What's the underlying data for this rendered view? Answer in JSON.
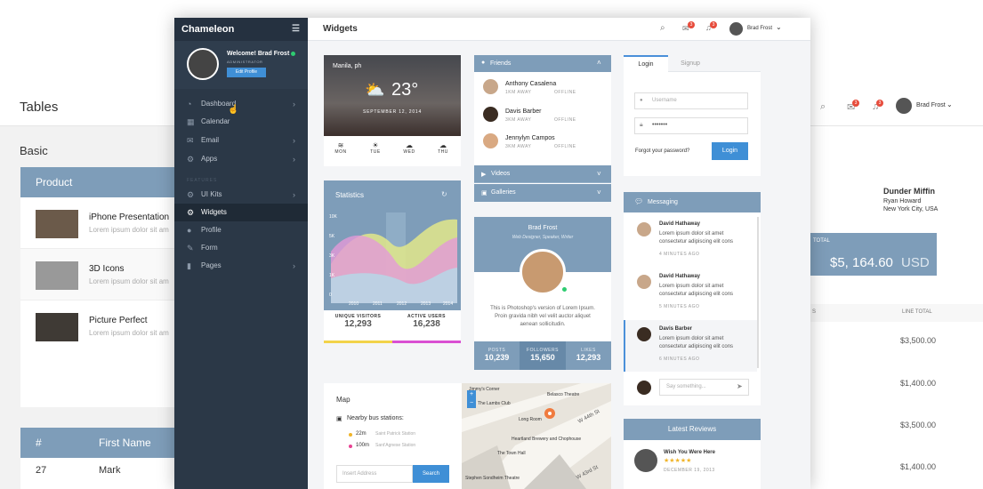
{
  "background_page": {
    "title": "Tables",
    "section": "Basic",
    "table_header": "Product",
    "products": [
      {
        "name": "iPhone Presentation",
        "desc": "Lorem ipsum dolor sit am"
      },
      {
        "name": "3D Icons",
        "desc": "Lorem ipsum dolor sit am"
      },
      {
        "name": "Picture Perfect",
        "desc": "Lorem ipsum dolor sit am"
      }
    ],
    "table2_headers": [
      "#",
      "First Name"
    ],
    "table2_row": [
      "27",
      "Mark"
    ],
    "user_name": "Brad Frost",
    "badge1": "3",
    "badge2": "3",
    "company": "Dunder Miffin",
    "contact": "Ryan Howard",
    "city": "New York City, USA",
    "total_label": "TOTAL",
    "total_value": "$5, 164.60",
    "total_currency": "USD",
    "col_label_left": "S",
    "col_label": "LINE TOTAL",
    "line_totals": [
      "$3,500.00",
      "$1,400.00",
      "$3,500.00",
      "$1,400.00"
    ]
  },
  "sidebar": {
    "brand": "Chameleon",
    "greeting": "Welcome! Brad Frost",
    "role": "ADMINISTRATOR",
    "edit_profile": "Edit Profile",
    "section_label": "FEATURES",
    "items": [
      {
        "label": "Dashboard",
        "icon": "dashboard-icon",
        "chevron": true
      },
      {
        "label": "Calendar",
        "icon": "calendar-icon",
        "chevron": false
      },
      {
        "label": "Email",
        "icon": "email-icon",
        "chevron": true
      },
      {
        "label": "Apps",
        "icon": "apps-icon",
        "chevron": true
      },
      {
        "label": "UI Kits",
        "icon": "ui-kits-icon",
        "chevron": true
      },
      {
        "label": "Widgets",
        "icon": "widgets-icon",
        "chevron": false
      },
      {
        "label": "Profile",
        "icon": "profile-icon",
        "chevron": false
      },
      {
        "label": "Form",
        "icon": "form-icon",
        "chevron": false
      },
      {
        "label": "Pages",
        "icon": "pages-icon",
        "chevron": true
      }
    ]
  },
  "header": {
    "title": "Widgets",
    "mail_badge": "3",
    "bell_badge": "3",
    "user": "Brad Frost"
  },
  "weather": {
    "location": "Manila, ph",
    "temp": "23°",
    "date": "SEPTEMBER 12, 2014",
    "days": [
      {
        "label": "MON",
        "icon": "≋"
      },
      {
        "label": "TUE",
        "icon": "☀"
      },
      {
        "label": "WED",
        "icon": "☁"
      },
      {
        "label": "THU",
        "icon": "☁"
      }
    ]
  },
  "statistics": {
    "title": "Statistics",
    "ylabels": [
      "10K",
      "5K",
      "3K",
      "1K",
      "0"
    ],
    "xlabels": [
      "2010",
      "2011",
      "2012",
      "2013",
      "2014"
    ],
    "stat1_label": "UNIQUE VISITORS",
    "stat1_value": "12,293",
    "stat2_label": "ACTIVE USERS",
    "stat2_value": "16,238"
  },
  "friends": {
    "title": "Friends",
    "people": [
      {
        "name": "Anthony Casalena",
        "distance": "1KM AWAY",
        "status": "OFFLINE"
      },
      {
        "name": "Davis Barber",
        "distance": "3KM AWAY",
        "status": "OFFLINE"
      },
      {
        "name": "Jennylyn Campos",
        "distance": "3KM AWAY",
        "status": "OFFLINE"
      }
    ],
    "videos": "Videos",
    "galleries": "Galleries"
  },
  "profile": {
    "name": "Brad Frost",
    "subtitle": "Web Designer, Speaker, Writer",
    "bio": "This is Photoshop's version  of Lorem Ipsum. Proin gravida nibh vel velit auctor aliquet aenean sollicitudin.",
    "stats": [
      {
        "label": "POSTS",
        "value": "10,239"
      },
      {
        "label": "FOLLOWERS",
        "value": "15,650"
      },
      {
        "label": "LIKES",
        "value": "12,293"
      }
    ]
  },
  "login": {
    "tab_login": "Login",
    "tab_signup": "Signup",
    "username_placeholder": "Username",
    "password_value": "•••••••",
    "forgot": "Forgot your password?",
    "button": "Login"
  },
  "messaging": {
    "title": "Messaging",
    "messages": [
      {
        "name": "David Hathaway",
        "text": "Lorem ipsum dolor sit amet consectetur adipiscing elit cons",
        "time": "4 MINUTES AGO"
      },
      {
        "name": "David Hathaway",
        "text": "Lorem ipsum dolor sit amet consectetur adipiscing elit cons",
        "time": "5 MINUTES AGO"
      },
      {
        "name": "Davis Barber",
        "text": "Lorem ipsum dolor sit amet consectetur adipiscing elit cons",
        "time": "6 MINUTES AGO"
      }
    ],
    "placeholder": "Say something..."
  },
  "map": {
    "title": "Map",
    "bus_label": "Nearby bus stations:",
    "stations": [
      {
        "distance": "22m",
        "name": "Saint Patrick Station",
        "color": "#f0b429"
      },
      {
        "distance": "100m",
        "name": "Sant'Agnese Station",
        "color": "#e84393"
      }
    ],
    "address_placeholder": "Insert Address",
    "search": "Search",
    "labels": [
      "Jimmy's Corner",
      "The Lambs Club",
      "Belasco Theatre",
      "Long Room",
      "W 44th St",
      "Heartland Brewery and Chophouse",
      "The Town Hall",
      "Stephen Sondheim Theatre",
      "W 43rd St"
    ]
  },
  "reviews": {
    "title": "Latest Reviews",
    "item_title": "Wish You Were Here",
    "stars": "★★★★★",
    "date": "DECEMBER 19, 2013"
  }
}
